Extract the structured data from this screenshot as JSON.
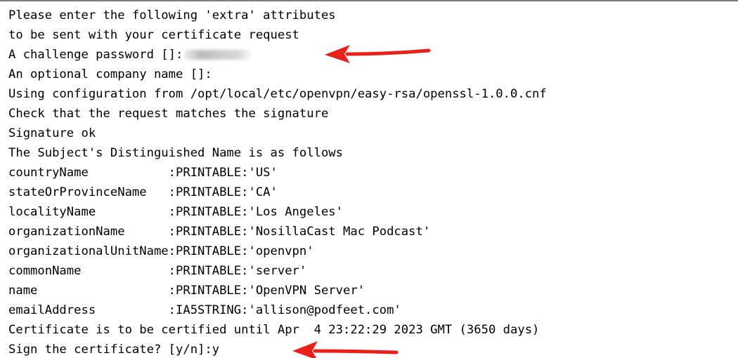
{
  "terminal": {
    "lines": [
      "Please enter the following 'extra' attributes",
      "to be sent with your certificate request",
      "A challenge password []:",
      "An optional company name []:",
      "Using configuration from /opt/local/etc/openvpn/easy-rsa/openssl-1.0.0.cnf",
      "Check that the request matches the signature",
      "Signature ok",
      "The Subject's Distinguished Name is as follows",
      "countryName           :PRINTABLE:'US'",
      "stateOrProvinceName   :PRINTABLE:'CA'",
      "localityName          :PRINTABLE:'Los Angeles'",
      "organizationName      :PRINTABLE:'NosillaCast Mac Podcast'",
      "organizationalUnitName:PRINTABLE:'openvpn'",
      "commonName            :PRINTABLE:'server'",
      "name                  :PRINTABLE:'OpenVPN Server'",
      "emailAddress          :IA5STRING:'allison@podfeet.com'",
      "Certificate is to be certified until Apr  4 23:22:29 2023 GMT (3650 days)",
      "Sign the certificate? [y/n]:y"
    ]
  },
  "annotations": {
    "arrow_color": "#e8211b",
    "arrow_icon": "left-arrow-icon"
  }
}
